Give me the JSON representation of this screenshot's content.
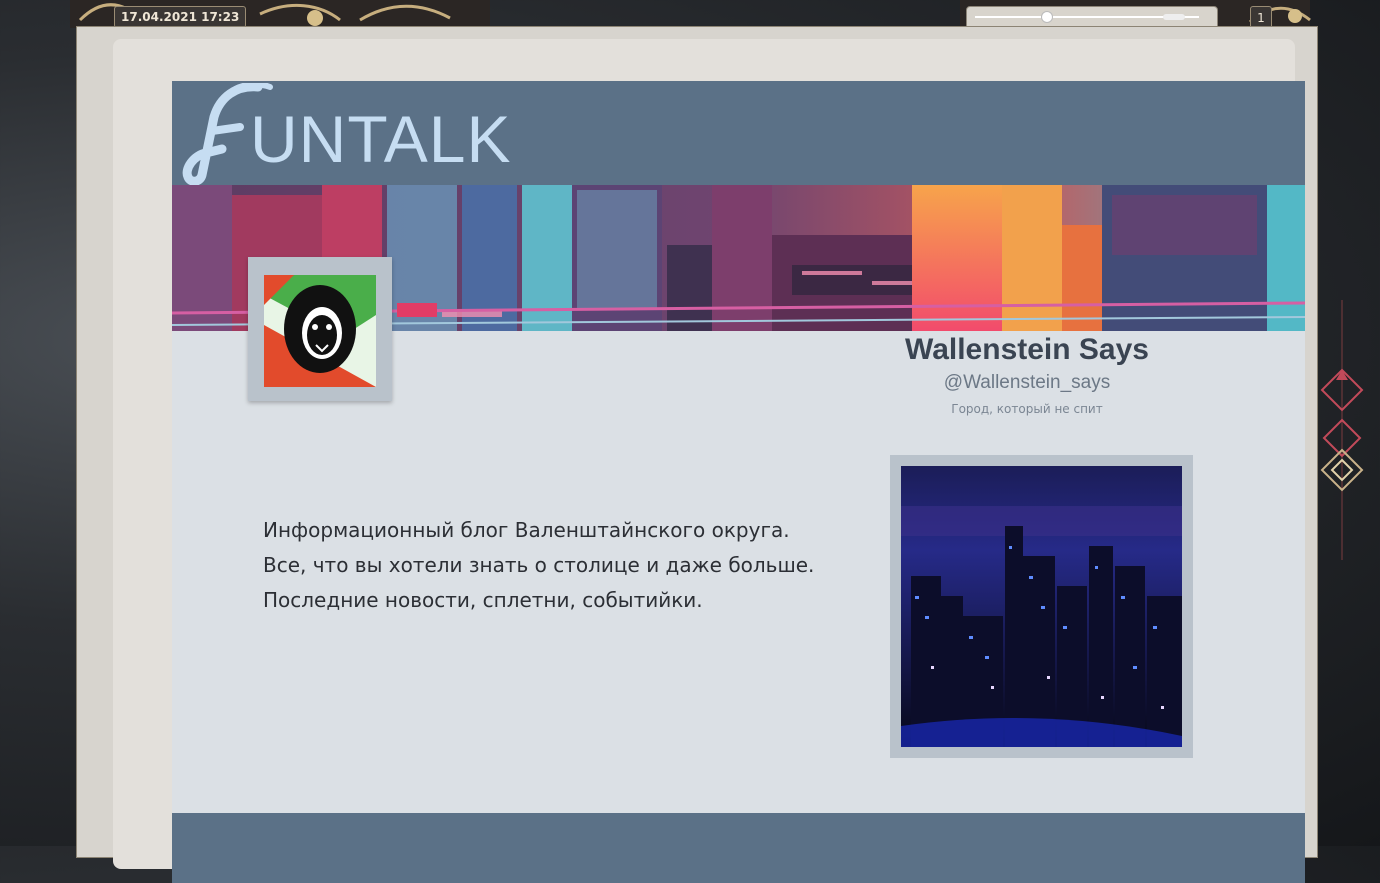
{
  "topbar": {
    "datetime": "17.04.2021 17:23",
    "page_count": "1",
    "zoom_level": 0.12
  },
  "header": {
    "logo_text": "UNTALK",
    "logo_letter_icon": "stylized-f-icon"
  },
  "profile": {
    "name": "Wallenstein Says",
    "handle": "@Wallenstein_says",
    "tagline": "Город, который не спит",
    "avatar_icon": "lion-head-icon"
  },
  "description": {
    "lines": [
      "Информационный блог Валенштайнского округа.",
      "Все, что вы хотели знать о столице и даже больше.",
      "Последние новости, сплетни, событийки."
    ]
  },
  "colors": {
    "header_bg": "#5b7187",
    "card_bg": "#dbe0e5",
    "logo_text": "#c6ddf2",
    "name_text": "#3a4452"
  }
}
